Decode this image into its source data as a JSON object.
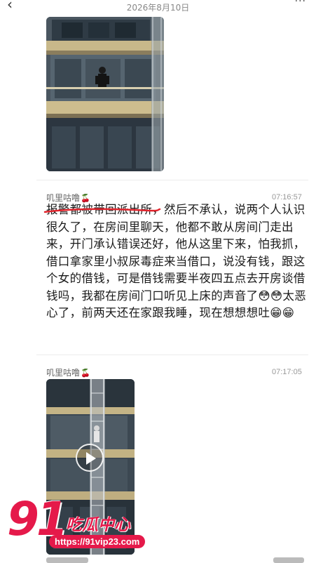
{
  "header": {
    "date": "2026年8月10日",
    "back_icon": "chevron-left-icon",
    "more_icon": "more-dots-icon"
  },
  "messages": [
    {
      "type": "image"
    },
    {
      "type": "text",
      "sender": "叽里咕噜",
      "sender_emoji": "🍒",
      "time": "07:16:57",
      "text": "报警都被带回派出所，然后不承认，说两个人认识很久了，在房间里聊天，他都不敢从房间门走出来，开门承认错误还好，他从这里下来，怕我抓，借口拿家里小叔尿毒症来当借口，说没有钱，跟这个女的借钱，可是借钱需要半夜四五点去开房谈借钱吗，我都在房间门口听见上床的声音了😳😳太恶心了，前两天还在家跟我睡，现在想想想吐😁😁",
      "strikethrough": "报警都被带回派出所"
    },
    {
      "type": "video",
      "sender": "叽里咕噜",
      "sender_emoji": "🍒",
      "time": "07:17:05"
    }
  ],
  "watermark": {
    "number": "91",
    "brand": "吃瓜中心",
    "url": "https://91vip23.com"
  },
  "colors": {
    "watermark_red": "#e5194a",
    "strike_red": "#e0242c",
    "timestamp_gray": "#999999"
  }
}
